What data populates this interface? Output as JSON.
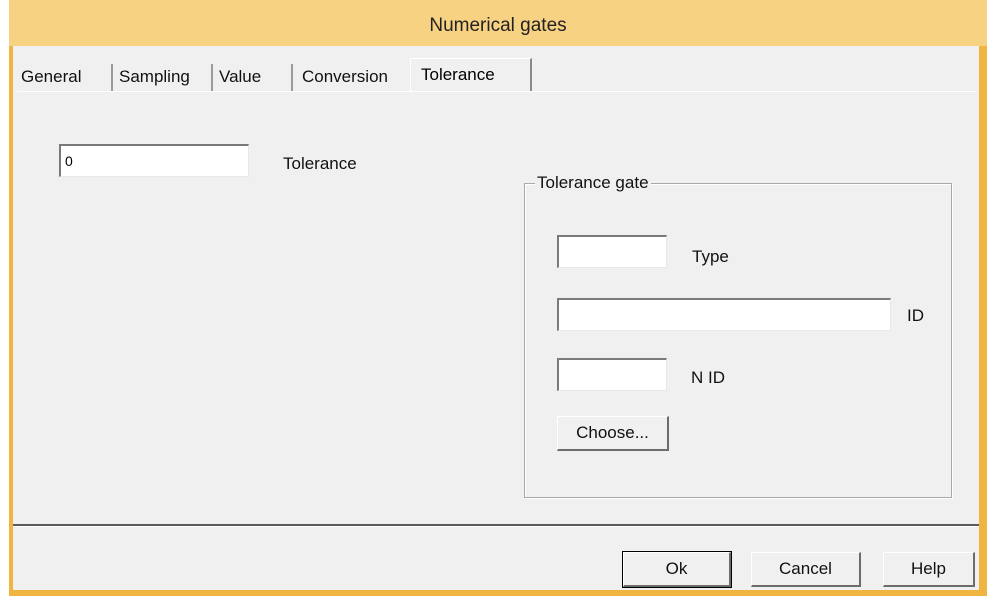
{
  "window": {
    "title": "Numerical gates"
  },
  "tabs": [
    {
      "label": "General"
    },
    {
      "label": "Sampling"
    },
    {
      "label": "Value"
    },
    {
      "label": "Conversion"
    },
    {
      "label": "Tolerance",
      "active": true
    }
  ],
  "tolerance": {
    "value": "0",
    "label": "Tolerance"
  },
  "tolerance_gate": {
    "title": "Tolerance gate",
    "type_label": "Type",
    "type_value": "",
    "id_label": "ID",
    "id_value": "",
    "nid_label": "N ID",
    "nid_value": "",
    "choose_label": "Choose..."
  },
  "footer": {
    "ok_label": "Ok",
    "cancel_label": "Cancel",
    "help_label": "Help"
  }
}
